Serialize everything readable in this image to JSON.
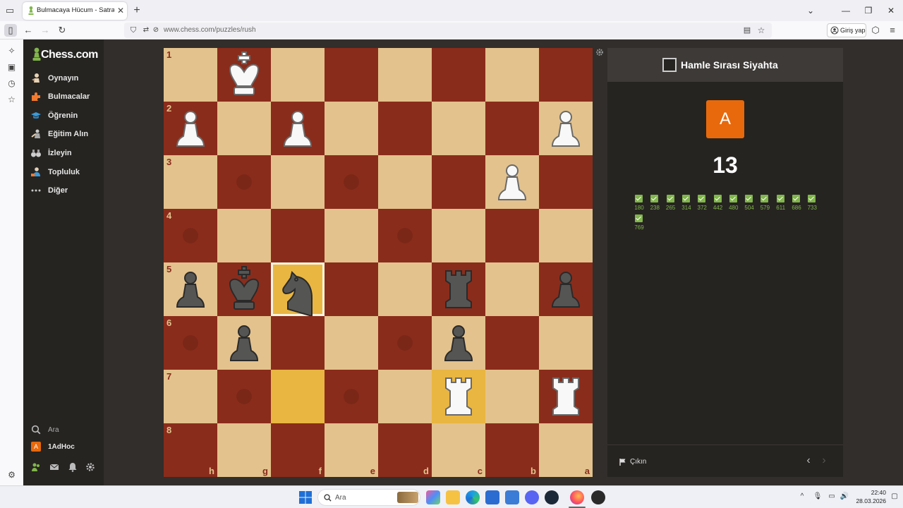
{
  "browser": {
    "tab_title": "Bulmacaya Hücum - Satranç Bu",
    "url": "www.chess.com/puzzles/rush",
    "login_label": "Giriş yap"
  },
  "sidebar": {
    "logo": "Chess.com",
    "items": [
      {
        "label": "Oynayın",
        "icon": "pawn-hand-icon"
      },
      {
        "label": "Bulmacalar",
        "icon": "puzzle-icon"
      },
      {
        "label": "Öğrenin",
        "icon": "graduation-cap-icon"
      },
      {
        "label": "Eğitim Alın",
        "icon": "coach-icon"
      },
      {
        "label": "İzleyin",
        "icon": "binoculars-icon"
      },
      {
        "label": "Topluluk",
        "icon": "community-icon"
      },
      {
        "label": "Diğer",
        "icon": "more-dots-icon"
      }
    ],
    "search_label": "Ara",
    "user": {
      "avatar_letter": "A",
      "name": "1AdHoc"
    }
  },
  "board": {
    "ranks": [
      "1",
      "2",
      "3",
      "4",
      "5",
      "6",
      "7",
      "8"
    ],
    "files": [
      "h",
      "g",
      "f",
      "e",
      "d",
      "c",
      "b",
      "a"
    ],
    "highlight_squares": [
      "f5",
      "f7",
      "c7"
    ],
    "selected_square": "f5",
    "move_dots": [
      "g3",
      "e3",
      "h4",
      "d4",
      "h6",
      "d6",
      "g7",
      "e7"
    ],
    "pieces": [
      {
        "sq": "g1",
        "type": "king",
        "color": "white"
      },
      {
        "sq": "h2",
        "type": "pawn",
        "color": "white"
      },
      {
        "sq": "f2",
        "type": "pawn",
        "color": "white"
      },
      {
        "sq": "a2",
        "type": "pawn",
        "color": "white"
      },
      {
        "sq": "b3",
        "type": "pawn",
        "color": "white"
      },
      {
        "sq": "h5",
        "type": "pawn",
        "color": "black"
      },
      {
        "sq": "g5",
        "type": "king",
        "color": "black"
      },
      {
        "sq": "f5",
        "type": "knight",
        "color": "black"
      },
      {
        "sq": "c5",
        "type": "rook",
        "color": "black"
      },
      {
        "sq": "a5",
        "type": "pawn",
        "color": "black"
      },
      {
        "sq": "g6",
        "type": "pawn",
        "color": "black"
      },
      {
        "sq": "c6",
        "type": "pawn",
        "color": "black"
      },
      {
        "sq": "c7",
        "type": "rook",
        "color": "white"
      },
      {
        "sq": "a7",
        "type": "rook",
        "color": "white"
      }
    ],
    "colors": {
      "light": "#e3c28d",
      "dark": "#8a2c1b",
      "highlight": "#e9b641"
    }
  },
  "panel": {
    "turn_text": "Hamle Sırası Siyahta",
    "rank_letter": "A",
    "score": "13",
    "results": [
      "180",
      "238",
      "265",
      "314",
      "372",
      "442",
      "480",
      "504",
      "579",
      "611",
      "686",
      "733",
      "769"
    ],
    "quit_label": "Çıkın"
  },
  "taskbar": {
    "search_label": "Ara",
    "time": "22:40",
    "date": "28.03.2026"
  }
}
